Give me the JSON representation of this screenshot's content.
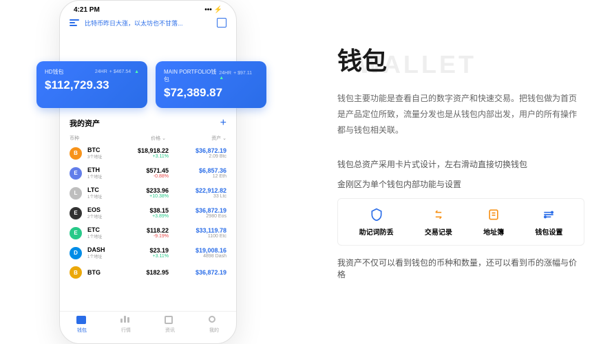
{
  "status_bar": {
    "time": "4:21 PM"
  },
  "news": "比特币昨日大涨，以太坊也不甘落...",
  "cards": [
    {
      "label": "HD钱包",
      "change_tag": "24HR",
      "change": "+ $467.54",
      "value": "$112,729.33"
    },
    {
      "label": "MAIN PORTFOLIO钱包",
      "change_tag": "24HR",
      "change": "+ $97.11",
      "value": "$72,389.87"
    }
  ],
  "quick_actions": [
    "助记词防丢",
    "交易记录",
    "地址簿",
    "钱包设置"
  ],
  "assets": {
    "title": "我的资产",
    "headers": {
      "coin": "币种",
      "price": "价格",
      "value": "资产"
    },
    "rows": [
      {
        "sym": "BTC",
        "sub": "3个地址",
        "price": "$18,918.22",
        "chg": "+3.11%",
        "chg_pos": true,
        "val": "$36,872.19",
        "amt": "2.09 Btc",
        "color": "#f7931a"
      },
      {
        "sym": "ETH",
        "sub": "1个地址",
        "price": "$571.45",
        "chg": "-0.88%",
        "chg_pos": false,
        "val": "$6,857.36",
        "amt": "12 Eth",
        "color": "#627eea"
      },
      {
        "sym": "LTC",
        "sub": "1个地址",
        "price": "$233.96",
        "chg": "+10.38%",
        "chg_pos": true,
        "val": "$22,912.82",
        "amt": "33 Ltc",
        "color": "#bebebe"
      },
      {
        "sym": "EOS",
        "sub": "2个地址",
        "price": "$38.15",
        "chg": "+3.89%",
        "chg_pos": true,
        "val": "$36,872.19",
        "amt": "2980 Eos",
        "color": "#333"
      },
      {
        "sym": "ETC",
        "sub": "1个地址",
        "price": "$118.22",
        "chg": "-9.19%",
        "chg_pos": false,
        "val": "$33,119.78",
        "amt": "1100 Etc",
        "color": "#28c989"
      },
      {
        "sym": "DASH",
        "sub": "1个地址",
        "price": "$23.19",
        "chg": "+3.11%",
        "chg_pos": true,
        "val": "$19,008.16",
        "amt": "4898 Dash",
        "color": "#008ce7"
      },
      {
        "sym": "BTG",
        "sub": "",
        "price": "$182.95",
        "chg": "",
        "chg_pos": true,
        "val": "$36,872.19",
        "amt": "",
        "color": "#eba80a"
      }
    ]
  },
  "tabs": [
    "钱包",
    "行情",
    "资讯",
    "我的"
  ],
  "text": {
    "bg": "WALLET",
    "title": "钱包",
    "desc": "钱包主要功能是查看自己的数字资产和快速交易。把钱包做为首页是产品定位所致，流量分发也是从钱包内部出发，用户的所有操作都与钱包相关联。",
    "f1": "钱包总资产采用卡片式设计，左右滑动直接切换钱包",
    "f2": "金刚区为单个钱包内部功能与设置",
    "f3": "我资产不仅可以看到钱包的币种和数量，还可以看到币的涨幅与价格"
  },
  "feature_box": [
    "助记词防丢",
    "交易记录",
    "地址簿",
    "钱包设置"
  ],
  "colors": {
    "primary": "#2a6de8",
    "orange": "#f7931a"
  }
}
